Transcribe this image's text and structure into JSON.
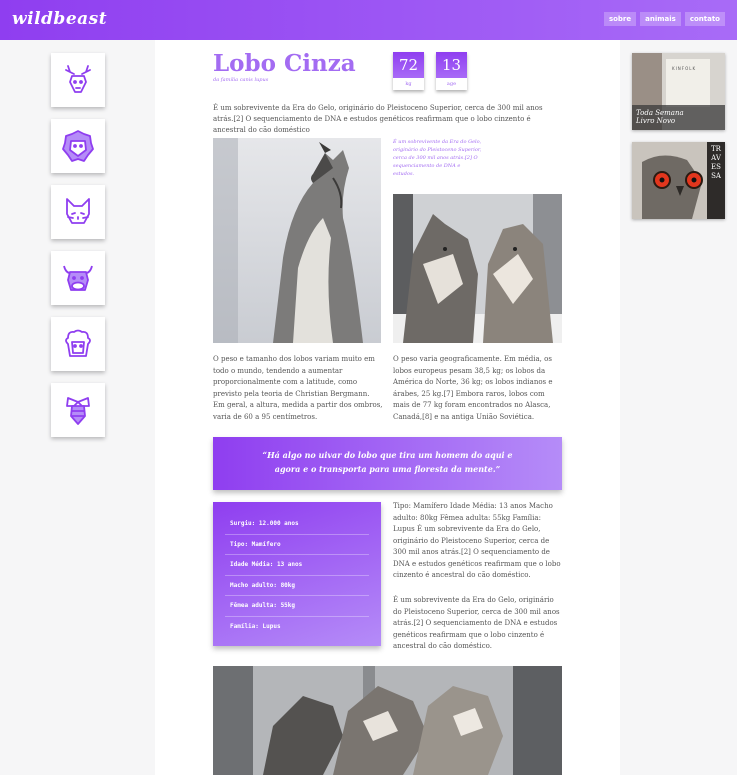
{
  "header": {
    "logo": "wildbeast",
    "nav": [
      "sobre",
      "animais",
      "contato"
    ]
  },
  "sidebar": {
    "icons": [
      "deer-icon",
      "lion-icon",
      "cat-icon",
      "bull-icon",
      "sheep-icon",
      "bee-icon"
    ]
  },
  "article": {
    "title": "Lobo Cinza",
    "subtitle": "da família canis lupus",
    "stats": [
      {
        "value": "72",
        "unit": "kg"
      },
      {
        "value": "13",
        "unit": "age"
      }
    ],
    "intro": "É um sobrevivente da Era do Gelo, originário do Pleistoceno Superior, cerca de 300 mil anos atrás.[2] O sequenciamento de DNA e estudos genéticos reafirmam que o lobo cinzento é ancestral do cão doméstico",
    "side_note": "É um sobrevivente da Era do Gelo, originário do Pleistoceno Superior, cerca de 300 mil anos atrás.[2] O sequenciamento de DNA e estudos.",
    "col_left": "O peso e tamanho dos lobos variam muito em todo o mundo, tendendo a aumentar proporcionalmente com a latitude, como previsto pela teoria de Christian Bergmann. Em geral, a altura, medida a partir dos ombros, varia de 60 a 95 centímetros.",
    "col_right": "O peso varia geograficamente. Em média, os lobos europeus pesam 38,5 kg; os lobos da América do Norte, 36 kg; os lobos indianos e árabes, 25 kg.[7] Embora raros, lobos com mais de 77 kg foram encontrados no Alasca, Canadá,[8] e na antiga União Soviética.",
    "quote_line1": "“Há algo no uivar do lobo que tira um homem do aqui e",
    "quote_line2": "agora e o transporta para uma floresta da mente.”",
    "facts": [
      "Surgiu: 12.000 anos",
      "Tipo: Mamífero",
      "Idade Média: 13 anos",
      "Macho adulto: 80kg",
      "Fêmea adulta: 55kg",
      "Família: Lupus"
    ],
    "facts_text_1": "Tipo: Mamífero Idade Média: 13 anos Macho adulto: 80kg Fêmea adulta: 55kg Família: Lupus É um sobrevivente da Era do Gelo, originário do Pleistoceno Superior, cerca de 300 mil anos atrás.[2] O sequenciamento de DNA e estudos genéticos reafirmam que o lobo cinzento é ancestral do cão doméstico.",
    "facts_text_2": "É um sobrevivente da Era do Gelo, originário do Pleistoceno Superior, cerca de 300 mil anos atrás.[2] O sequenciamento de DNA e estudos genéticos reafirmam que o lobo cinzento é ancestral do cão doméstico."
  },
  "ads": [
    {
      "caption_line1": "Toda Semana",
      "caption_line2": "Livro Novo",
      "brand": "KINFOLK"
    },
    {
      "vertical_text": "TRAVESSA"
    }
  ],
  "colors": {
    "accent": "#a36cf2",
    "gradient_start": "#8f3ef0",
    "gradient_end": "#a86bf7"
  }
}
